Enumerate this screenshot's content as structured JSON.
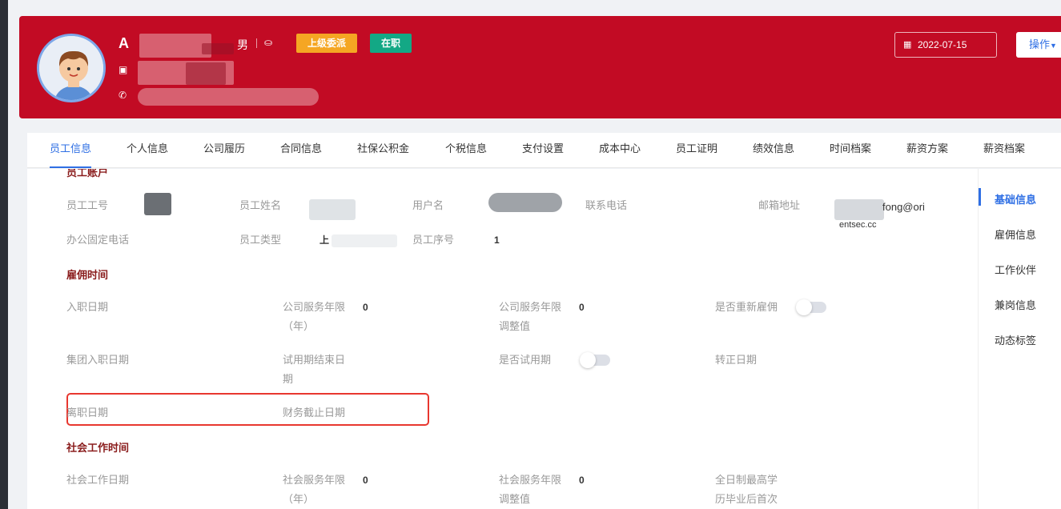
{
  "profile": {
    "name": "A",
    "gender": "男",
    "badges": [
      "上级委派",
      "在职"
    ],
    "date": "2022-07-15",
    "ops_label": "操作"
  },
  "tabs": [
    "员工信息",
    "个人信息",
    "公司履历",
    "合同信息",
    "社保公积金",
    "个税信息",
    "支付设置",
    "成本中心",
    "员工证明",
    "绩效信息",
    "时间档案",
    "薪资方案",
    "薪资档案"
  ],
  "right_nav": [
    "基础信息",
    "雇佣信息",
    "工作伙伴",
    "兼岗信息",
    "动态标签"
  ],
  "sections": {
    "account_title": "员工账户",
    "account": {
      "employee_id": "员工工号",
      "employee_name": "员工姓名",
      "username": "用户名",
      "phone": "联系电话",
      "email": "邮箱地址",
      "email_value_a": "fong@ori",
      "email_value_b": "entsec.cc",
      "office_phone": "办公固定电话",
      "employee_type": "员工类型",
      "employee_type_value": "上",
      "employee_seq": "员工序号",
      "employee_seq_value": "1"
    },
    "hire_title": "雇佣时间",
    "hire": {
      "entry_date": "入职日期",
      "service_years": "公司服务年限",
      "service_years_unit": "（年）",
      "service_years_value": "0",
      "service_adjust": "公司服务年限",
      "service_adjust_2": "调整值",
      "service_adjust_value": "0",
      "rehire": "是否重新雇佣",
      "group_entry": "集团入职日期",
      "probation_end": "试用期结束日",
      "probation_end_2": "期",
      "is_probation": "是否试用期",
      "regular_date": "转正日期",
      "leave_date": "离职日期",
      "finance_cutoff": "财务截止日期"
    },
    "social_title": "社会工作时间",
    "social": {
      "social_date": "社会工作日期",
      "social_years": "社会服务年限",
      "social_years_unit": "（年）",
      "social_years_value": "0",
      "social_adjust": "社会服务年限",
      "social_adjust_2": "调整值",
      "social_adjust_value": "0",
      "edu": "全日制最高学",
      "edu_2": "历毕业后首次"
    }
  }
}
